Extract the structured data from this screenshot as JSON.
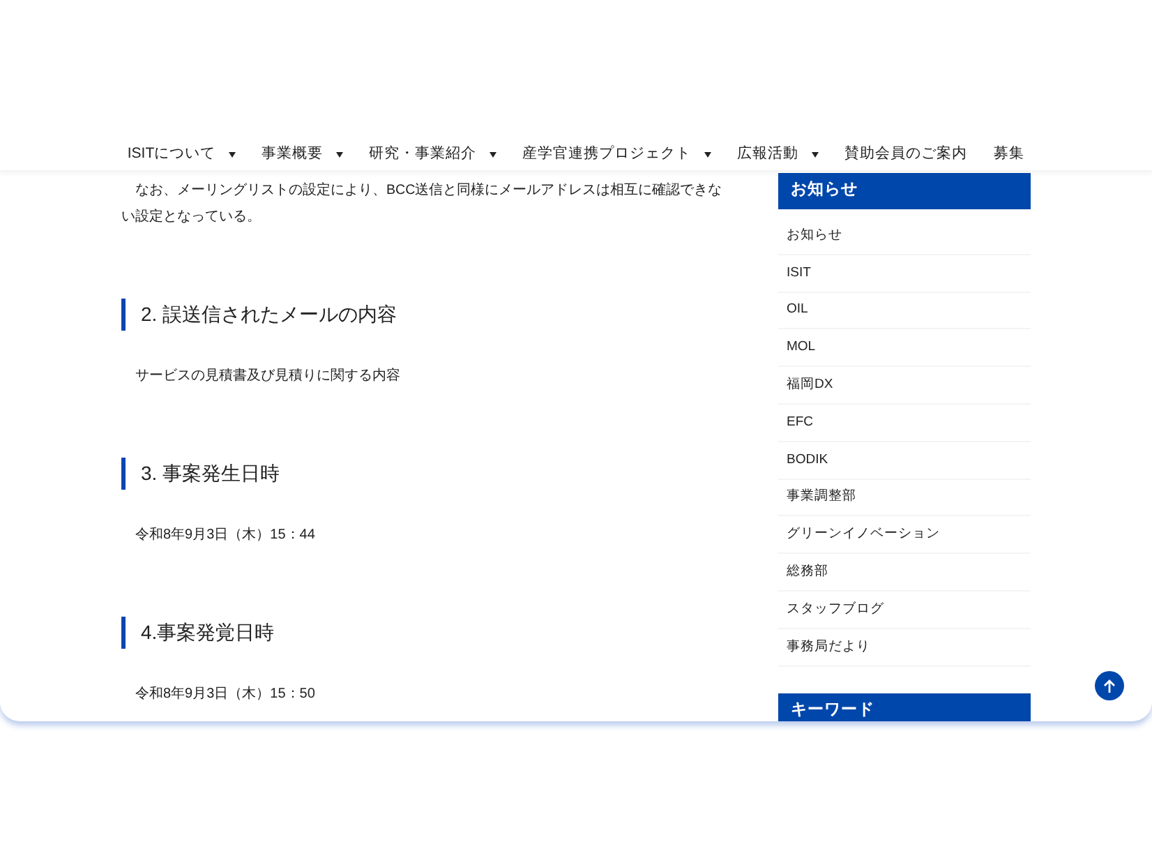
{
  "nav": {
    "items": [
      {
        "label": "ISITについて",
        "dropdown": true
      },
      {
        "label": "事業概要",
        "dropdown": true
      },
      {
        "label": "研究・事業紹介",
        "dropdown": true
      },
      {
        "label": "産学官連携プロジェクト",
        "dropdown": true
      },
      {
        "label": "広報活動",
        "dropdown": true
      },
      {
        "label": "賛助会員のご案内",
        "dropdown": false
      },
      {
        "label": "募集",
        "dropdown": false
      }
    ]
  },
  "article": {
    "intro": "なお、メーリングリストの設定により、BCC送信と同様にメールアドレスは相互に確認できない設定となっている。",
    "sections": [
      {
        "heading": "2. 誤送信されたメールの内容",
        "body": "サービスの見積書及び見積りに関する内容"
      },
      {
        "heading": "3. 事案発生日時",
        "body": "令和8年9月3日（木）15：44"
      },
      {
        "heading": "4.事案発覚日時",
        "body": "令和8年9月3日（木）15：50"
      }
    ]
  },
  "sidebar": {
    "widgets": [
      {
        "title": "お知らせ",
        "items": [
          "お知らせ",
          "ISIT",
          "OIL",
          "MOL",
          "福岡DX",
          "EFC",
          "BODIK",
          "事業調整部",
          "グリーンイノベーション",
          "総務部",
          "スタッフブログ",
          "事務局だより"
        ]
      },
      {
        "title": "キーワード"
      }
    ]
  }
}
